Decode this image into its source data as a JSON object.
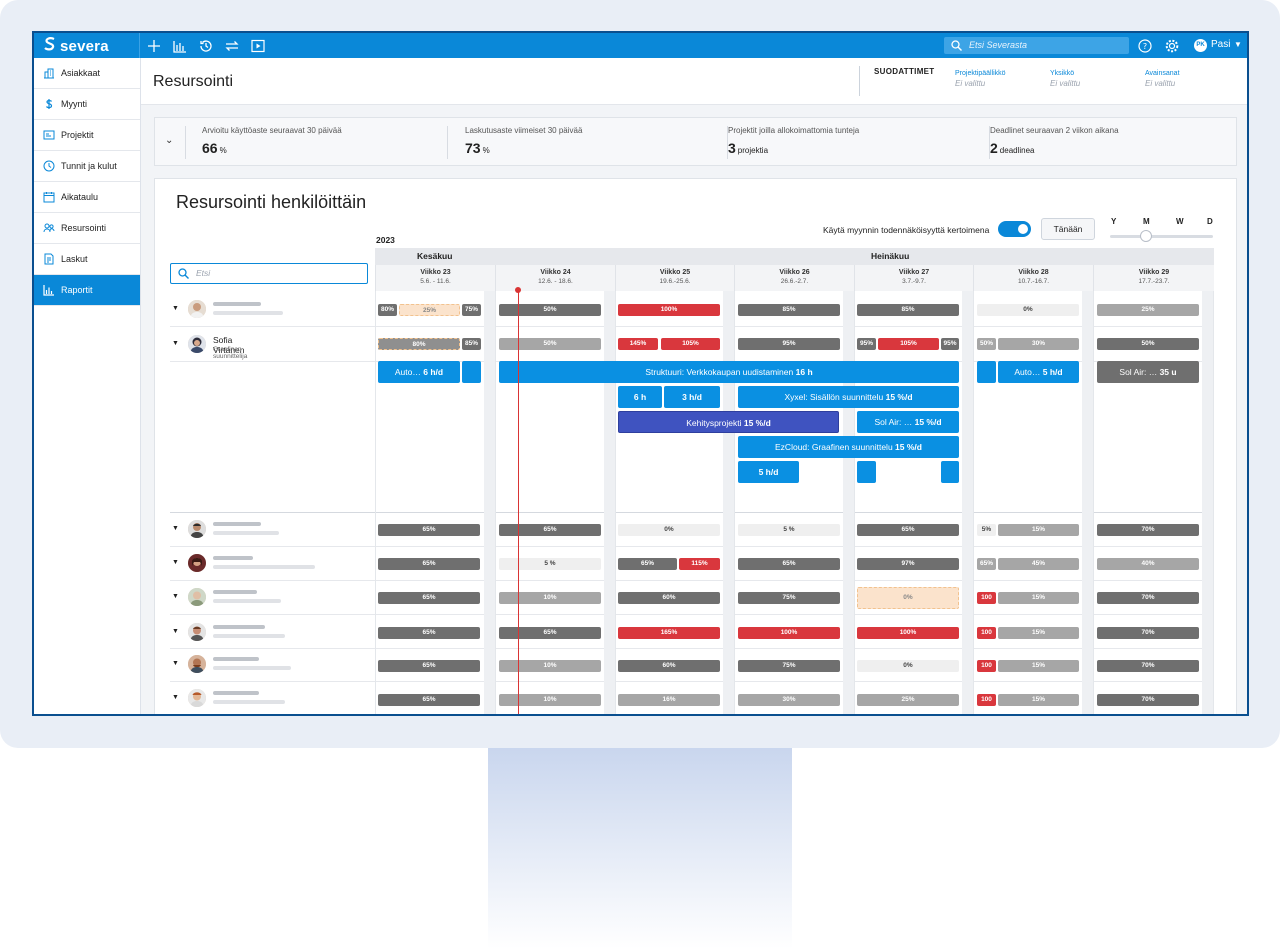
{
  "app": {
    "brand": "severa",
    "search_placeholder": "Etsi Severasta",
    "user_initials": "PK",
    "user_name": "Pasi"
  },
  "toolbar": {
    "icons": [
      "plus-icon",
      "bar-chart-icon",
      "history-icon",
      "swap-icon",
      "play-icon"
    ]
  },
  "sidebar": {
    "items": [
      {
        "label": "Asiakkaat",
        "icon": "building-icon"
      },
      {
        "label": "Myynti",
        "icon": "dollar-icon"
      },
      {
        "label": "Projektit",
        "icon": "project-icon"
      },
      {
        "label": "Tunnit ja kulut",
        "icon": "clock-icon"
      },
      {
        "label": "Aikataulu",
        "icon": "calendar-icon"
      },
      {
        "label": "Resursointi",
        "icon": "people-icon"
      },
      {
        "label": "Laskut",
        "icon": "invoice-icon"
      },
      {
        "label": "Raportit",
        "icon": "report-icon",
        "active": true
      }
    ]
  },
  "header": {
    "title": "Resursointi",
    "filters_label": "SUODATTIMET",
    "filters": [
      {
        "label": "Projektipäällikkö",
        "value": "Ei valittu"
      },
      {
        "label": "Yksikkö",
        "value": "Ei valittu"
      },
      {
        "label": "Avainsanat",
        "value": "Ei valittu"
      }
    ]
  },
  "kpis": [
    {
      "label": "Arvioitu käyttöaste seuraavat 30 päivää",
      "value": "66",
      "unit": "%"
    },
    {
      "label": "Laskutusaste viimeiset 30 päivää",
      "value": "73",
      "unit": "%"
    },
    {
      "label": "Projektit joilla allokoimattomia tunteja",
      "value": "3",
      "unit": "projektia"
    },
    {
      "label": "Deadlinet seuraavan 2 viikon aikana",
      "value": "2",
      "unit": "deadlinea"
    }
  ],
  "panel": {
    "title": "Resursointi henkilöittäin",
    "probability_label": "Käytä myynnin todennäköisyyttä kertoimena",
    "today_button": "Tänään",
    "zoom_labels": [
      "Y",
      "M",
      "W",
      "D"
    ],
    "search_placeholder": "Etsi",
    "year": "2023",
    "months": [
      "Kesäkuu",
      "Heinäkuu"
    ],
    "weeks": [
      {
        "label": "Viikko 23",
        "dates": "5.6. - 11.6."
      },
      {
        "label": "Viikko 24",
        "dates": "12.6. - 18.6."
      },
      {
        "label": "Viikko 25",
        "dates": "19.6.-25.6."
      },
      {
        "label": "Viikko 26",
        "dates": "26.6.-2.7."
      },
      {
        "label": "Viikko 27",
        "dates": "3.7.-9.7."
      },
      {
        "label": "Viikko 28",
        "dates": "10.7.-16.7."
      },
      {
        "label": "Viikko 29",
        "dates": "17.7.-23.7."
      }
    ],
    "featured_person": {
      "name": "Sofia Virtanen",
      "role": "Graafinen suunnittelija"
    },
    "bar_values": {
      "r0": [
        "80%",
        "25%",
        "75%",
        "50%",
        "100%",
        "85%",
        "85%",
        "0%",
        "25%"
      ],
      "r1": [
        "80%",
        "85%",
        "50%",
        "145%",
        "105%",
        "95%",
        "95%",
        "105%",
        "95%",
        "50%",
        "30%",
        "50%"
      ],
      "r2": [
        "65%",
        "65%",
        "0%",
        "5 %",
        "65%",
        "5%",
        "15%",
        "70%"
      ],
      "r3": [
        "65%",
        "5 %",
        "65%",
        "115%",
        "65%",
        "97%",
        "65%",
        "45%",
        "40%"
      ],
      "r4": [
        "65%",
        "10%",
        "60%",
        "75%",
        "0%",
        "100",
        "15%",
        "70%"
      ],
      "r5": [
        "65%",
        "65%",
        "165%",
        "100%",
        "100%",
        "100",
        "15%",
        "70%"
      ],
      "r6": [
        "65%",
        "10%",
        "60%",
        "75%",
        "0%",
        "100",
        "15%",
        "70%"
      ],
      "r7": [
        "65%",
        "10%",
        "16%",
        "30%",
        "25%",
        "100",
        "15%",
        "70%"
      ]
    },
    "tasks": {
      "t1": {
        "text": "Auto…",
        "hours": "6 h/d"
      },
      "t2": {
        "text": "Struktuuri: Verkkokaupan uudistaminen",
        "hours": "16 h"
      },
      "t3": {
        "text": "Auto…",
        "hours": "5 h/d"
      },
      "t4": {
        "text": "Sol Air: …",
        "hours": "35 u"
      },
      "t5": {
        "text": "",
        "hours": "6 h"
      },
      "t6": {
        "text": "",
        "hours": "3 h/d"
      },
      "t7": {
        "text": "Xyxel: Sisällön suunnittelu",
        "hours": "15 %/d"
      },
      "t8": {
        "text": "Kehitysprojekti",
        "hours": "15 %/d"
      },
      "t9": {
        "text": "Sol Air: …",
        "hours": "15 %/d"
      },
      "t10": {
        "text": "EzCloud: Graafinen suunnittelu",
        "hours": "15 %/d"
      },
      "t11": {
        "text": "",
        "hours": "5 h/d"
      }
    }
  }
}
